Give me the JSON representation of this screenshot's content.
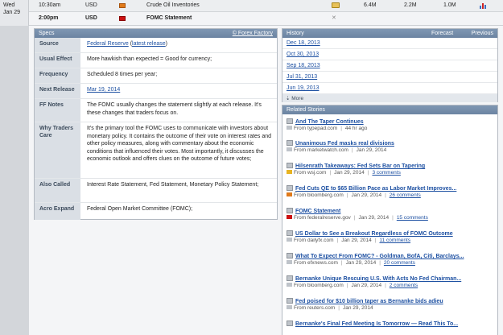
{
  "calendar": {
    "day": "Wed",
    "date": "Jan 29",
    "rows": [
      {
        "time": "10:30am",
        "currency": "USD",
        "event": "Crude Oil Inventories",
        "actual": "6.4M",
        "forecast": "2.2M",
        "previous": "1.0M"
      },
      {
        "time": "2:00pm",
        "currency": "USD",
        "event": "FOMC Statement"
      }
    ]
  },
  "specs": {
    "title": "Specs",
    "source_link": "© Forex Factory",
    "rows": [
      {
        "label": "Source",
        "link1": "Federal Reserve",
        "mid": " (",
        "link2": "latest release",
        "end": ")"
      },
      {
        "label": "Usual Effect",
        "value": "More hawkish than expected = Good for currency;"
      },
      {
        "label": "Frequency",
        "value": "Scheduled 8 times per year;"
      },
      {
        "label": "Next Release",
        "link": "Mar 19, 2014"
      },
      {
        "label": "FF Notes",
        "value": "The FOMC usually changes the statement slightly at each release. It's these changes that traders focus on."
      },
      {
        "label": "Why Traders Care",
        "value": "It's the primary tool the FOMC uses to communicate with investors about monetary policy. It contains the outcome of their vote on interest rates and other policy measures, along with commentary about the economic conditions that influenced their votes. Most importantly, it discusses the economic outlook and offers clues on the outcome of future votes;"
      },
      {
        "label": "Also Called",
        "value": "Interest Rate Statement, Fed Statement, Monetary Policy Statement;"
      },
      {
        "label": "Acro Expand",
        "value": "Federal Open Market Committee (FOMC);"
      }
    ]
  },
  "history": {
    "title": "History",
    "forecast_label": "Forecast",
    "previous_label": "Previous",
    "dates": [
      "Dec 18, 2013",
      "Oct 30, 2013",
      "Sep 18, 2013",
      "Jul 31, 2013",
      "Jun 19, 2013"
    ],
    "more": "⇣ More"
  },
  "related": {
    "title": "Related Stories",
    "stories": [
      {
        "title": "And The Taper Continues",
        "from": "From typepad.com",
        "time": "44 hr ago",
        "comments": "",
        "src_color": "#bfc4ca"
      },
      {
        "title": "Unanimous Fed masks real divisions",
        "from": "From marketwatch.com",
        "time": "Jan 29, 2014",
        "comments": "",
        "src_color": "#bfc4ca"
      },
      {
        "title": "Hilsenrath Takeaways: Fed Sets Bar on Tapering",
        "from": "From wsj.com",
        "time": "Jan 29, 2014",
        "comments": "3 comments",
        "src_color": "#e8b422"
      },
      {
        "title": "Fed Cuts QE to $65 Billion Pace as Labor Market Improves...",
        "from": "From bloomberg.com",
        "time": "Jan 29, 2014",
        "comments": "26 comments",
        "src_color": "#e07a1a"
      },
      {
        "title": "FOMC Statement",
        "from": "From federalreserve.gov",
        "time": "Jan 29, 2014",
        "comments": "15 comments",
        "src_color": "#cc1111"
      },
      {
        "title": "US Dollar to See a Breakout Regardless of FOMC Outcome",
        "from": "From dailyfx.com",
        "time": "Jan 29, 2014",
        "comments": "11 comments",
        "src_color": "#bfc4ca"
      },
      {
        "title": "What To Expect From FOMC? - Goldman, BofA, Citi, Barclays...",
        "from": "From efxnews.com",
        "time": "Jan 29, 2014",
        "comments": "20 comments",
        "src_color": "#bfc4ca"
      },
      {
        "title": "Bernanke Unique Rescuing U.S. With Acts No Fed Chairman...",
        "from": "From bloomberg.com",
        "time": "Jan 29, 2014",
        "comments": "2 comments",
        "src_color": "#bfc4ca"
      },
      {
        "title": "Fed poised for $10 billion taper as Bernanke bids adieu",
        "from": "From reuters.com",
        "time": "Jan 29, 2014",
        "comments": "",
        "src_color": "#bfc4ca"
      },
      {
        "title": "Bernanke's Final Fed Meeting Is Tomorrow — Read This To...",
        "from": "",
        "time": "",
        "comments": "",
        "src_color": "#bfc4ca"
      }
    ]
  },
  "colors": {
    "header": "#6c84a2",
    "link": "#1d50a2",
    "label_bg": "#dadfe5"
  }
}
